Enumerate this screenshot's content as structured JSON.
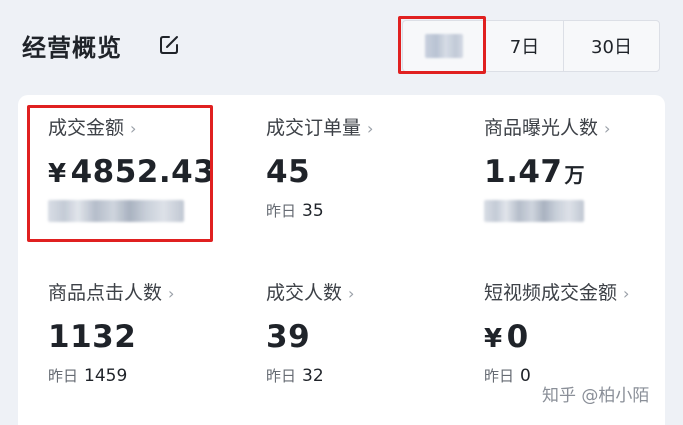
{
  "header": {
    "title": "经营概览",
    "edit_icon": "edit-icon",
    "range_options": [
      {
        "label": "",
        "redacted": true,
        "selected": true
      },
      {
        "label": "7日"
      },
      {
        "label": "30日"
      }
    ]
  },
  "metrics": [
    {
      "label": "成交金额",
      "currency": "¥",
      "value": "4852.43",
      "unit": "",
      "prev_label": "",
      "prev_value": "",
      "prev_redacted": true,
      "highlighted": true
    },
    {
      "label": "成交订单量",
      "currency": "",
      "value": "45",
      "unit": "",
      "prev_label": "昨日",
      "prev_value": "35"
    },
    {
      "label": "商品曝光人数",
      "currency": "",
      "value": "1.47",
      "unit": "万",
      "prev_label": "",
      "prev_value": "",
      "prev_redacted": true
    },
    {
      "label": "商品点击人数",
      "currency": "",
      "value": "1132",
      "unit": "",
      "prev_label": "昨日",
      "prev_value": "1459"
    },
    {
      "label": "成交人数",
      "currency": "",
      "value": "39",
      "unit": "",
      "prev_label": "昨日",
      "prev_value": "32"
    },
    {
      "label": "短视频成交金额",
      "currency": "¥",
      "value": "0",
      "unit": "",
      "prev_label": "昨日",
      "prev_value": "0"
    }
  ],
  "chevron_glyph": "›",
  "watermark": "知乎 @柏小陌",
  "colors": {
    "highlight": "#e02020",
    "background": "#eef1f6",
    "card": "#ffffff"
  }
}
